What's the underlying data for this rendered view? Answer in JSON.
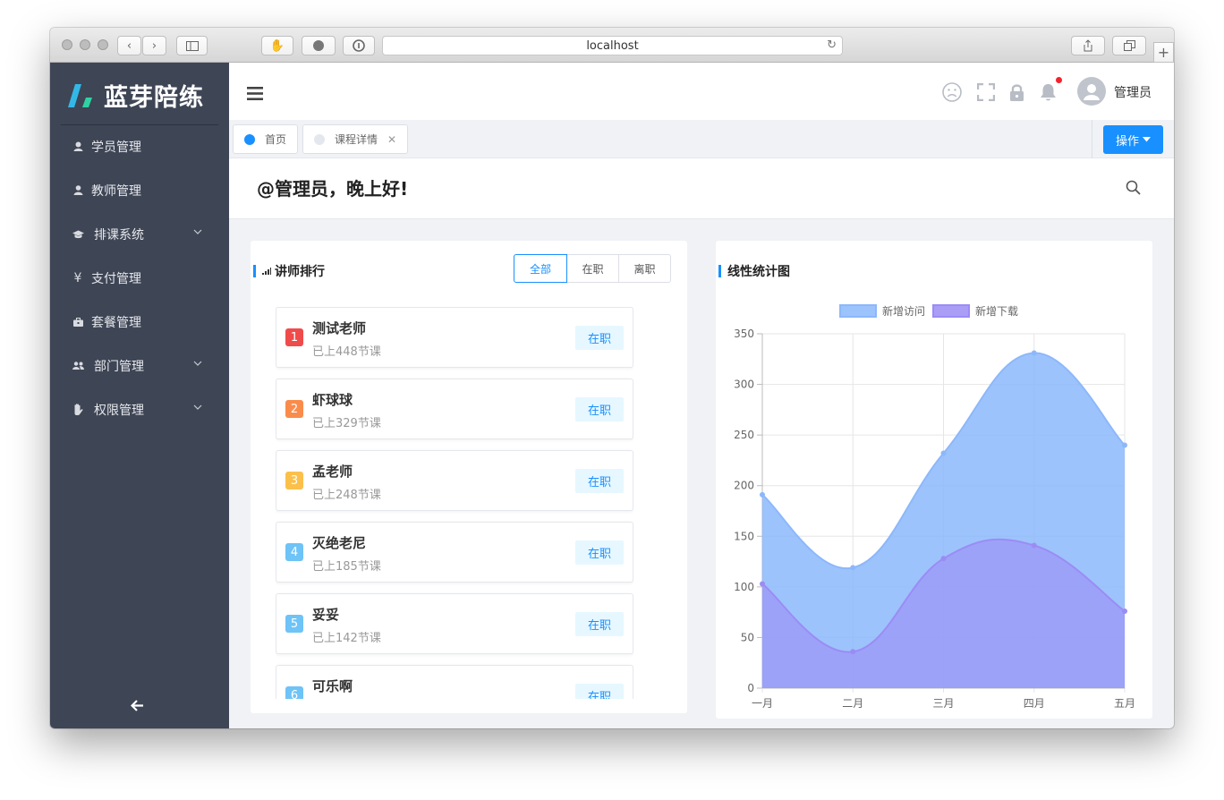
{
  "browser": {
    "url": "localhost"
  },
  "sidebar": {
    "logo_text": "蓝芽陪练",
    "items": [
      {
        "label": "学员管理",
        "icon": "student-icon",
        "expandable": false
      },
      {
        "label": "教师管理",
        "icon": "user-icon",
        "expandable": false
      },
      {
        "label": "排课系统",
        "icon": "graduation-cap-icon",
        "expandable": true
      },
      {
        "label": "支付管理",
        "icon": "yen-icon",
        "expandable": false
      },
      {
        "label": "套餐管理",
        "icon": "briefcase-icon",
        "expandable": false
      },
      {
        "label": "部门管理",
        "icon": "users-icon",
        "expandable": true
      },
      {
        "label": "权限管理",
        "icon": "hand-icon",
        "expandable": true
      }
    ],
    "collapse_icon": "arrow-left-icon"
  },
  "header": {
    "username": "管理员",
    "has_notification": true
  },
  "tabs": [
    {
      "label": "首页",
      "active": true,
      "closable": false
    },
    {
      "label": "课程详情",
      "active": false,
      "closable": true
    }
  ],
  "ops_button": {
    "label": "操作"
  },
  "greeting": "@管理员，晚上好!",
  "teacher_panel": {
    "title": "讲师排行",
    "filters": [
      {
        "label": "全部",
        "active": true
      },
      {
        "label": "在职",
        "active": false
      },
      {
        "label": "离职",
        "active": false
      }
    ],
    "teachers": [
      {
        "rank": "1",
        "name": "测试老师",
        "lessons": "已上448节课",
        "status": "在职"
      },
      {
        "rank": "2",
        "name": "虾球球",
        "lessons": "已上329节课",
        "status": "在职"
      },
      {
        "rank": "3",
        "name": "孟老师",
        "lessons": "已上248节课",
        "status": "在职"
      },
      {
        "rank": "4",
        "name": "灭绝老尼",
        "lessons": "已上185节课",
        "status": "在职"
      },
      {
        "rank": "5",
        "name": "妥妥",
        "lessons": "已上142节课",
        "status": "在职"
      },
      {
        "rank": "6",
        "name": "可乐啊",
        "lessons": "",
        "status": "在职"
      }
    ]
  },
  "chart_panel": {
    "title": "线性统计图"
  },
  "colors": {
    "primary": "#1890ff",
    "sidebar_bg": "#3e4555",
    "rank_1": "#f04b4b",
    "rank_2": "#fa8c4b",
    "rank_3": "#fbc04b",
    "rank_rest": "#6ec3f7",
    "series_visits": "#8cb8fb",
    "series_downloads": "#9b8cf5"
  },
  "chart_data": {
    "type": "area",
    "categories": [
      "一月",
      "二月",
      "三月",
      "四月",
      "五月"
    ],
    "ylim": [
      0,
      350
    ],
    "yticks": [
      0,
      50,
      100,
      150,
      200,
      250,
      300,
      350
    ],
    "grid": true,
    "smooth": true,
    "legend": "top-center",
    "series": [
      {
        "name": "新增访问",
        "values": [
          191,
          119,
          232,
          331,
          240
        ],
        "color": "#8cb8fb"
      },
      {
        "name": "新增下载",
        "values": [
          103,
          36,
          128,
          141,
          76
        ],
        "color": "#9b8cf5"
      }
    ]
  }
}
